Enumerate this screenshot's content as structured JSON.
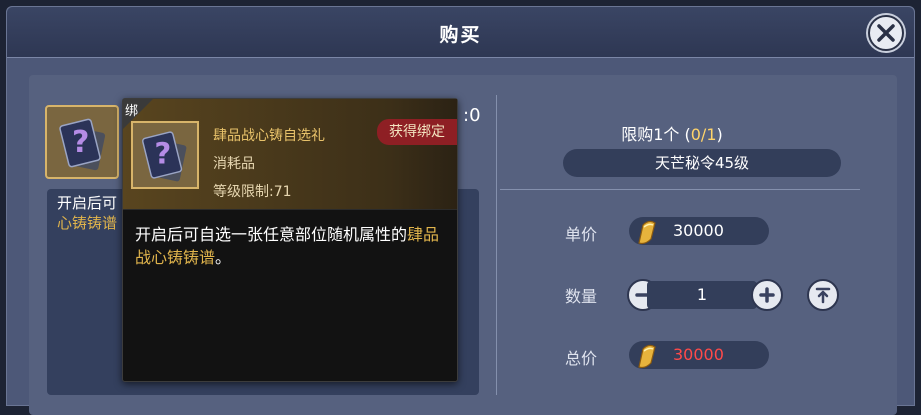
{
  "dialog": {
    "title": "购买"
  },
  "item": {
    "count_partial": ":0",
    "desc_line1_partial": "开启后可",
    "desc_line2_partial": "心铸铸谱"
  },
  "tooltip": {
    "bound_corner": "绑",
    "name": "肆品战心铸自选礼",
    "type": "消耗品",
    "level_limit": "等级限制:71",
    "bound_badge": "获得绑定",
    "desc_part1": "开启后可自选一张任意部位随机属",
    "desc_part2": "性的",
    "desc_highlight": "肆品战心铸铸谱",
    "desc_part3": "。"
  },
  "purchase": {
    "limit_prefix": "限购1个 (",
    "limit_count": "0/1",
    "limit_suffix": ")",
    "level_requirement": "天芒秘令45级",
    "unit_price_label": "单价",
    "unit_price": "30000",
    "quantity_label": "数量",
    "quantity": "1",
    "total_label": "总价",
    "total_price": "30000"
  },
  "colors": {
    "accent_gold": "#e0b44c",
    "total_price_red": "#ff4a4a",
    "bound_badge_red": "#8e1f24"
  },
  "icons": [
    "close-icon",
    "mystery-card-icon",
    "gold-coin-icon",
    "minus-icon",
    "plus-icon",
    "max-icon"
  ]
}
